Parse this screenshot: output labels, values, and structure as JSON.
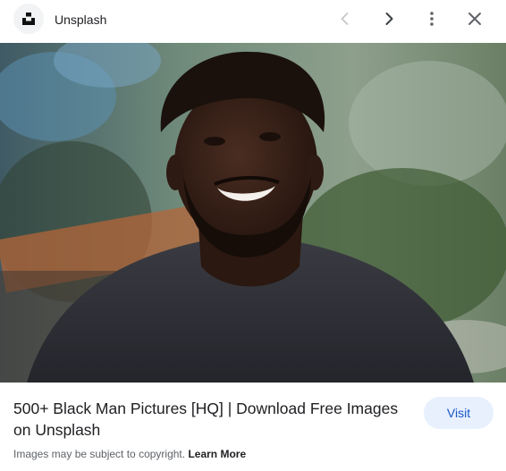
{
  "header": {
    "site_name": "Unsplash",
    "favicon_icon": "unsplash-logo-icon",
    "icons": {
      "back": "chevron-left-icon",
      "forward": "chevron-right-icon",
      "more": "more-vert-icon",
      "close": "close-icon"
    }
  },
  "image": {
    "subject": "smiling-man-photo"
  },
  "result": {
    "title": "500+ Black Man Pictures [HQ] | Download Free Images on Unsplash",
    "visit_label": "Visit",
    "copyright_text": "Images may be subject to copyright.",
    "learn_more_label": "Learn More"
  },
  "colors": {
    "visit_bg": "#e8f0fe",
    "visit_text": "#1a56c4",
    "disabled_icon": "#bdc1c6",
    "icon": "#5f6368"
  }
}
